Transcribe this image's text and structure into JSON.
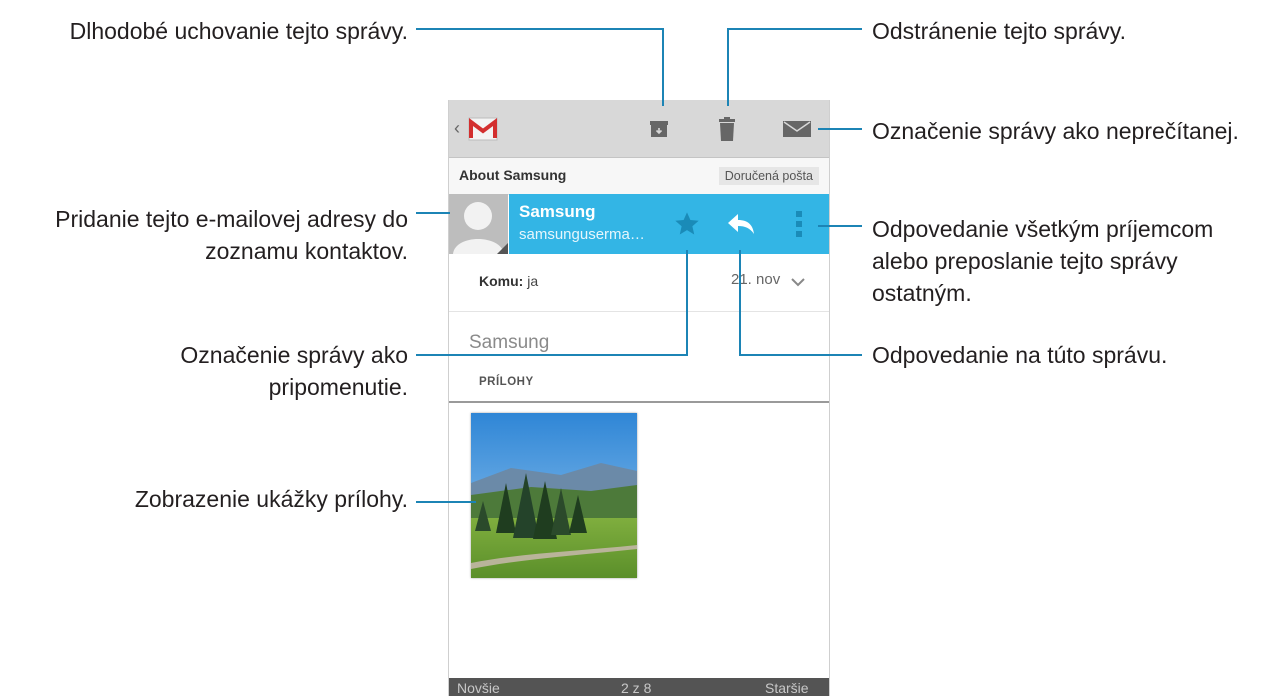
{
  "callouts": {
    "archive": "Dlhodobé uchovanie tejto správy.",
    "delete": "Odstránenie tejto správy.",
    "unread": "Označenie správy ako neprečítanej.",
    "add_contact_1": "Pridanie tejto e-mailovej adresy do",
    "add_contact_2": "zoznamu kontaktov.",
    "reply_all_1": "Odpovedanie všetkým príjemcom",
    "reply_all_2": "alebo preposlanie tejto správy",
    "reply_all_3": "ostatným.",
    "star_1": "Označenie správy ako",
    "star_2": "pripomenutie.",
    "reply": "Odpovedanie na túto správu.",
    "preview": "Zobrazenie ukážky prílohy."
  },
  "app": {
    "icons": {
      "back": "back-chevron-icon",
      "logo": "gmail-logo-icon",
      "archive": "archive-icon",
      "delete": "trash-icon",
      "unread": "mark-unread-icon",
      "star": "star-icon",
      "reply": "reply-icon",
      "menu": "overflow-menu-icon"
    },
    "subject": "About Samsung",
    "folder": "Doručená pošta",
    "sender": {
      "name": "Samsung",
      "email": "samsunguserma…"
    },
    "recipient_label": "Komu:",
    "recipient_value": "ja",
    "date": "21. nov",
    "greeting": "Samsung",
    "attachments_header": "PRÍLOHY",
    "bottom": {
      "newer": "Novšie",
      "position": "2 z 8",
      "older": "Staršie"
    }
  },
  "colors": {
    "accent": "#33b5e5",
    "leader": "#1c84b5",
    "action_bar": "#d8d8d8"
  }
}
